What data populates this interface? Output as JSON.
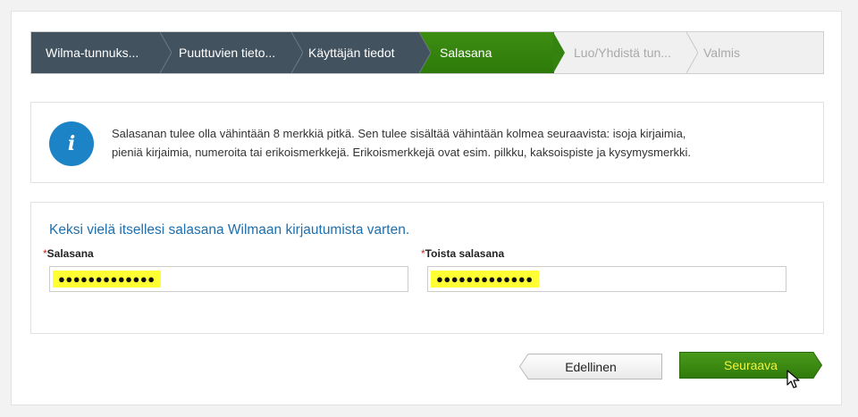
{
  "steps": [
    {
      "label": "Wilma-tunnuks...",
      "state": "done"
    },
    {
      "label": "Puuttuvien tieto...",
      "state": "done"
    },
    {
      "label": "Käyttäjän tiedot",
      "state": "done"
    },
    {
      "label": "Salasana",
      "state": "active"
    },
    {
      "label": "Luo/Yhdistä tun...",
      "state": "todo"
    },
    {
      "label": "Valmis",
      "state": "todo"
    }
  ],
  "info": {
    "icon": "info-icon",
    "icon_glyph": "i",
    "line1": "Salasanan tulee olla vähintään 8 merkkiä pitkä. Sen tulee sisältää vähintään kolmea seuraavista: isoja kirjaimia,",
    "line2": "pieniä kirjaimia, numeroita tai erikoismerkkejä. Erikoismerkkejä ovat esim. pilkku, kaksoispiste ja kysymysmerkki."
  },
  "form": {
    "title": "Keksi vielä itsellesi salasana Wilmaan kirjautumista varten.",
    "required_mark": "*",
    "password_label": "Salasana",
    "password_value": "●●●●●●●●●●●●●",
    "confirm_label": "Toista salasana",
    "confirm_value": "●●●●●●●●●●●●●"
  },
  "buttons": {
    "prev": "Edellinen",
    "next": "Seuraava"
  },
  "colors": {
    "done": "#42535f",
    "active": "#3a8a10",
    "todo": "#f0f0f0",
    "accent_blue": "#1c84c6",
    "title_blue": "#1d6fae",
    "highlight": "#ffff33",
    "next_text": "#f3f33a"
  }
}
